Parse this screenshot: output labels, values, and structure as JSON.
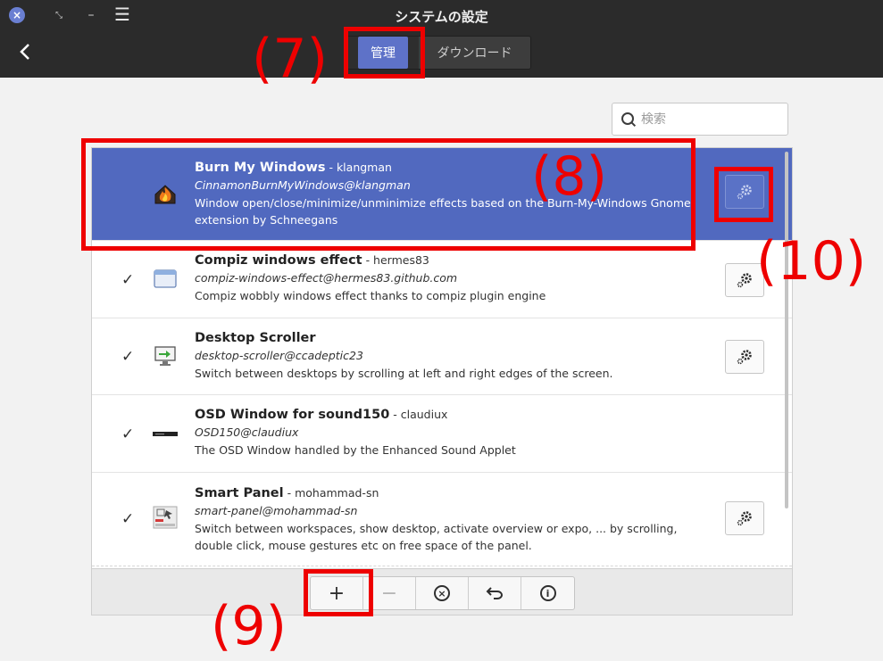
{
  "window": {
    "title": "システムの設定",
    "menu_glyph": "☰",
    "back_glyph": "‹"
  },
  "tabs": [
    {
      "label": "管理",
      "active": true
    },
    {
      "label": "ダウンロード",
      "active": false
    }
  ],
  "search": {
    "placeholder": "検索",
    "value": ""
  },
  "extensions": [
    {
      "name": "Burn My Windows",
      "author": " - klangman",
      "uuid": "CinnamonBurnMyWindows@klangman",
      "description": "Window open/close/minimize/unminimize effects based on the Burn-My-Windows Gnome extension by Schneegans",
      "enabled": false,
      "selected": true,
      "icon": "fire-window-icon",
      "has_config": true
    },
    {
      "name": "Compiz windows effect",
      "author": " - hermes83",
      "uuid": "compiz-windows-effect@hermes83.github.com",
      "description": "Compiz wobbly windows effect thanks to compiz plugin engine",
      "enabled": true,
      "selected": false,
      "icon": "window-icon",
      "has_config": true
    },
    {
      "name": "Desktop Scroller",
      "author": "",
      "uuid": "desktop-scroller@ccadeptic23",
      "description": "Switch between desktops by scrolling at left and right edges of the screen.",
      "enabled": true,
      "selected": false,
      "icon": "monitor-arrow-icon",
      "has_config": true
    },
    {
      "name": "OSD Window for sound150",
      "author": " - claudiux",
      "uuid": "OSD150@claudiux",
      "description": "The OSD Window handled by the Enhanced Sound Applet",
      "enabled": true,
      "selected": false,
      "icon": "osd-bar-icon",
      "has_config": false
    },
    {
      "name": "Smart Panel",
      "author": " - mohammad-sn",
      "uuid": "smart-panel@mohammad-sn",
      "description": "Switch between workspaces, show desktop, activate overview or expo, ... by scrolling, double click, mouse gestures etc on free space of the panel.",
      "enabled": true,
      "selected": false,
      "icon": "smart-panel-icon",
      "has_config": true
    }
  ],
  "toolbar": {
    "add": "+",
    "remove": "−",
    "uninstall": "×",
    "undo": "↶",
    "info": "i"
  },
  "annotations": {
    "a7": "(7)",
    "a8": "(8)",
    "a9": "(9)",
    "a10": "(10)"
  },
  "colors": {
    "headerbar": "#2b2b2b",
    "accent": "#5e72c8",
    "selected_row": "#5169bf",
    "annotation": "#ee0000"
  }
}
